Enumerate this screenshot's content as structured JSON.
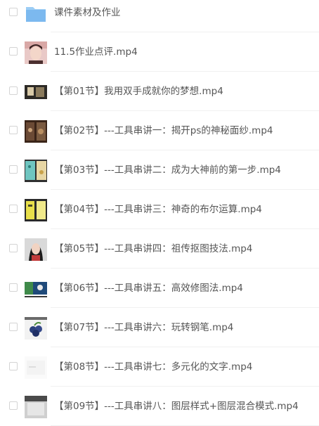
{
  "file_list": {
    "items": [
      {
        "name": "课件素材及作业",
        "type": "folder-icon"
      },
      {
        "name": "11.5作业点评.mp4",
        "type": "video-thumbnail"
      },
      {
        "name": "【第01节】我用双手成就你的梦想.mp4",
        "type": "video-thumbnail"
      },
      {
        "name": "【第02节】---工具串讲一：揭开ps的神秘面纱.mp4",
        "type": "video-thumbnail"
      },
      {
        "name": "【第03节】---工具串讲二：成为大神前的第一步.mp4",
        "type": "video-thumbnail"
      },
      {
        "name": "【第04节】---工具串讲三：神奇的布尔运算.mp4",
        "type": "video-thumbnail"
      },
      {
        "name": "【第05节】---工具串讲四：祖传抠图技法.mp4",
        "type": "video-thumbnail"
      },
      {
        "name": "【第06节】---工具串讲五：高效修图法.mp4",
        "type": "video-thumbnail"
      },
      {
        "name": "【第07节】---工具串讲六：玩转钢笔.mp4",
        "type": "video-thumbnail"
      },
      {
        "name": "【第08节】---工具串讲七：多元化的文字.mp4",
        "type": "video-thumbnail"
      },
      {
        "name": "【第09节】---工具串讲八：图层样式+图层混合模式.mp4",
        "type": "video-thumbnail"
      }
    ]
  },
  "colors": {
    "folder": "#7cb9ef",
    "text": "#555555",
    "divider": "#f0f0f0",
    "checkbox_border": "#d4d4d4"
  }
}
